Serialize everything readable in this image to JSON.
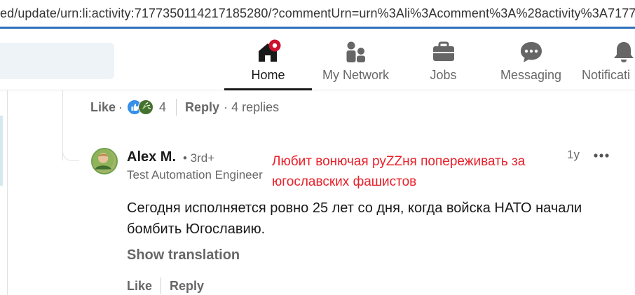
{
  "browser": {
    "url": "ed/update/urn:li:activity:7177350114217185280/?commentUrn=urn%3Ali%3Acomment%3A%28activity%3A7177350114"
  },
  "nav": {
    "items": [
      {
        "label": "Home",
        "icon": "home-icon",
        "active": true
      },
      {
        "label": "My Network",
        "icon": "people-icon"
      },
      {
        "label": "Jobs",
        "icon": "briefcase-icon"
      },
      {
        "label": "Messaging",
        "icon": "chat-icon"
      },
      {
        "label": "Notificati",
        "icon": "bell-icon"
      }
    ]
  },
  "previous_comment": {
    "like_label": "Like",
    "separator": "·",
    "reaction_count": "4",
    "reply_label": "Reply",
    "replies_label": "· 4 replies"
  },
  "comment": {
    "author_name": "Alex M.",
    "degree": "• 3rd+",
    "headline": "Test Automation Engineer",
    "overlay_note": "Любит вонючая руZZня попереживать за югославских фашистов",
    "timestamp": "1y",
    "body": "Сегодня исполняется ровно 25 лет со дня, когда войска НАТО начали бомбить Югославию.",
    "show_translation": "Show translation",
    "like_label": "Like",
    "reply_label": "Reply"
  },
  "colors": {
    "accent": "#2f6fbd",
    "notification_badge": "#cb112d",
    "overlay_text": "#e8202a",
    "like_reaction": "#378fe9",
    "celebrate_reaction": "#44712e"
  }
}
